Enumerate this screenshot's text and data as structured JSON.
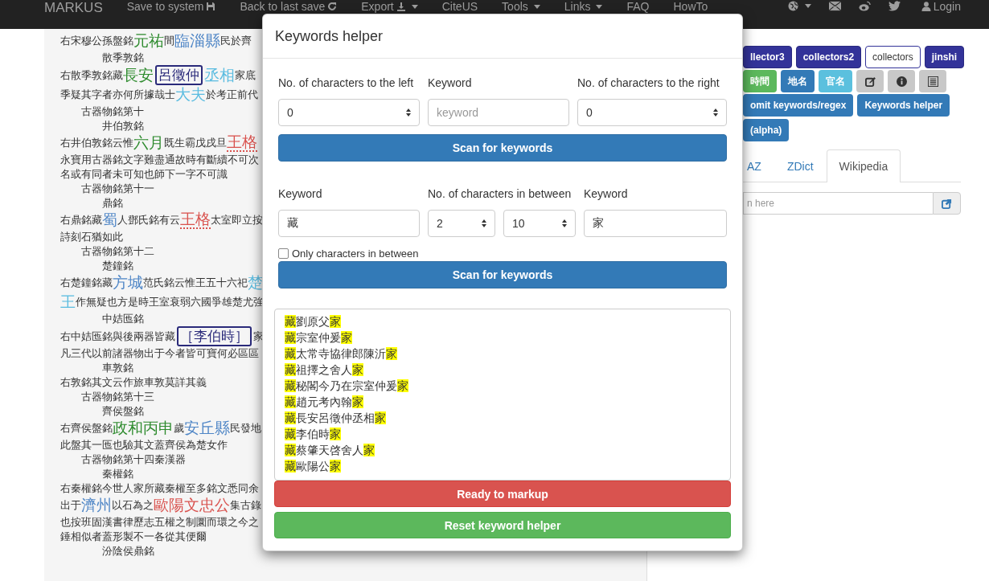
{
  "navbar": {
    "brand": "MARKUS",
    "items": [
      {
        "label": "Save to system",
        "dropdown": false
      },
      {
        "label": "Back to last save",
        "dropdown": false
      },
      {
        "label": "Export",
        "dropdown": true
      },
      {
        "label": "CiteUS",
        "dropdown": false
      },
      {
        "label": "Tools",
        "dropdown": true
      },
      {
        "label": "Links",
        "dropdown": true
      },
      {
        "label": "FAQ",
        "dropdown": false
      },
      {
        "label": "HowTo",
        "dropdown": false
      }
    ],
    "icon_items": [
      {
        "dropdown": true
      },
      {
        "dropdown": false
      },
      {
        "dropdown": false
      },
      {
        "dropdown": false
      }
    ],
    "login": "Login"
  },
  "text_lines": [
    {
      "kind": "text",
      "segments": [
        {
          "text": "右宋穆公孫盤銘",
          "kind": "plain"
        },
        {
          "text": "元祐",
          "kind": "time"
        },
        {
          "text": "間",
          "kind": "plain"
        },
        {
          "text": "臨淄縣",
          "kind": "place"
        },
        {
          "text": "民於齊",
          "kind": "plain"
        }
      ]
    },
    {
      "kind": "item",
      "segments": [
        {
          "text": "散季敦銘",
          "kind": "plain"
        }
      ]
    },
    {
      "kind": "text",
      "segments": [
        {
          "text": "右散季敦銘藏",
          "kind": "plain"
        },
        {
          "text": "長安",
          "kind": "time"
        },
        {
          "text": "呂徵仲",
          "kind": "person"
        },
        {
          "text": "丞相",
          "kind": "office"
        },
        {
          "text": "家底",
          "kind": "plain"
        }
      ]
    },
    {
      "kind": "text",
      "segments": [
        {
          "text": "季疑其字者亦何所據哉士",
          "kind": "plain"
        },
        {
          "text": "大夫",
          "kind": "office"
        },
        {
          "text": "於考正前代",
          "kind": "plain"
        }
      ]
    },
    {
      "kind": "section",
      "segments": [
        {
          "text": "古器物銘第十",
          "kind": "plain"
        }
      ]
    },
    {
      "kind": "item",
      "segments": [
        {
          "text": "井伯敦銘",
          "kind": "plain"
        }
      ]
    },
    {
      "kind": "text",
      "segments": [
        {
          "text": "右井伯敦銘云惟",
          "kind": "plain"
        },
        {
          "text": "六月",
          "kind": "time"
        },
        {
          "text": "既生霸戊戌旦",
          "kind": "plain"
        },
        {
          "text": "王格",
          "kind": "title"
        }
      ]
    },
    {
      "kind": "text",
      "segments": [
        {
          "text": "永寶用古器銘文字難盡通故時有斷續不可次",
          "kind": "plain"
        }
      ]
    },
    {
      "kind": "text",
      "segments": [
        {
          "text": "名或有同者未可知也師下一字不可識",
          "kind": "plain"
        }
      ]
    },
    {
      "kind": "section",
      "segments": [
        {
          "text": "古器物銘第十一",
          "kind": "plain"
        }
      ]
    },
    {
      "kind": "item",
      "segments": [
        {
          "text": "鼎銘",
          "kind": "plain"
        }
      ]
    },
    {
      "kind": "text",
      "segments": [
        {
          "text": "右鼎銘藏",
          "kind": "plain"
        },
        {
          "text": "蜀",
          "kind": "place"
        },
        {
          "text": "人鄧氏銘有云",
          "kind": "plain"
        },
        {
          "text": "王格",
          "kind": "title"
        },
        {
          "text": "太室即立按",
          "kind": "plain"
        }
      ]
    },
    {
      "kind": "text",
      "segments": [
        {
          "text": "詩刻石猶如此",
          "kind": "plain"
        }
      ]
    },
    {
      "kind": "section",
      "segments": [
        {
          "text": "古器物銘第十二",
          "kind": "plain"
        }
      ]
    },
    {
      "kind": "item",
      "segments": [
        {
          "text": "楚鐘銘",
          "kind": "plain"
        }
      ]
    },
    {
      "kind": "text",
      "segments": [
        {
          "text": "右楚鐘銘藏",
          "kind": "plain"
        },
        {
          "text": "方城",
          "kind": "place"
        },
        {
          "text": "范氏銘云惟王五十六祀",
          "kind": "plain"
        },
        {
          "text": "楚",
          "kind": "office"
        }
      ]
    },
    {
      "kind": "text",
      "segments": [
        {
          "text": "王",
          "kind": "office"
        },
        {
          "text": "作無疑也方是時王室衰弱六國爭雄楚尤強",
          "kind": "plain"
        }
      ]
    },
    {
      "kind": "item",
      "segments": [
        {
          "text": "中姞匜銘",
          "kind": "plain"
        }
      ]
    },
    {
      "kind": "text",
      "segments": [
        {
          "text": "右中姞匜銘與後兩器皆藏",
          "kind": "plain"
        },
        {
          "text": "［李伯時］",
          "kind": "person"
        },
        {
          "text": "家",
          "kind": "plain"
        }
      ]
    },
    {
      "kind": "text",
      "segments": [
        {
          "text": "凡三代以前諸器物出于今者皆可寶何必區區",
          "kind": "plain"
        }
      ]
    },
    {
      "kind": "item",
      "segments": [
        {
          "text": "車敦銘",
          "kind": "plain"
        }
      ]
    },
    {
      "kind": "text",
      "segments": [
        {
          "text": "右敦銘其文云作旅車敦莫詳其義",
          "kind": "plain"
        }
      ]
    },
    {
      "kind": "section",
      "segments": [
        {
          "text": "古器物銘第十三",
          "kind": "plain"
        }
      ]
    },
    {
      "kind": "item",
      "segments": [
        {
          "text": "齊侯盤銘",
          "kind": "plain"
        }
      ]
    },
    {
      "kind": "text",
      "segments": [
        {
          "text": "右齊侯盤銘",
          "kind": "plain"
        },
        {
          "text": "政和丙申",
          "kind": "time"
        },
        {
          "text": "歲",
          "kind": "plain"
        },
        {
          "text": "安丘縣",
          "kind": "place"
        },
        {
          "text": "民發地",
          "kind": "plain"
        }
      ]
    },
    {
      "kind": "text",
      "segments": [
        {
          "text": "此盤其一匜也驗其文蓋齊侯為楚女作",
          "kind": "plain"
        }
      ]
    },
    {
      "kind": "section",
      "segments": [
        {
          "text": "古器物銘第十四秦漢器",
          "kind": "plain"
        }
      ]
    },
    {
      "kind": "item",
      "segments": [
        {
          "text": "秦權銘",
          "kind": "plain"
        }
      ]
    },
    {
      "kind": "text",
      "segments": [
        {
          "text": "右秦權銘今世人家所藏秦權至多銘文悉同余",
          "kind": "plain"
        }
      ]
    },
    {
      "kind": "text",
      "segments": [
        {
          "text": "出于",
          "kind": "plain"
        },
        {
          "text": "濟州",
          "kind": "place"
        },
        {
          "text": "以石為之",
          "kind": "plain"
        },
        {
          "text": "歐陽文忠公",
          "kind": "name"
        },
        {
          "text": "集古錄",
          "kind": "plain"
        }
      ]
    },
    {
      "kind": "text",
      "segments": [
        {
          "text": "也按班固漢書律歷志五權之制圜而環之今之",
          "kind": "plain"
        }
      ]
    },
    {
      "kind": "text",
      "segments": [
        {
          "text": "錘相似者蓋形製不一各從其便爾",
          "kind": "plain"
        }
      ]
    },
    {
      "kind": "item",
      "segments": [
        {
          "text": "汾陰侯鼎銘",
          "kind": "plain"
        }
      ]
    }
  ],
  "tag_buttons": [
    {
      "label": "llector3",
      "selected": false
    },
    {
      "label": "collectors2",
      "selected": false
    },
    {
      "label": "collectors",
      "selected": true
    },
    {
      "label": "jinshi",
      "selected": false
    }
  ],
  "markup_buttons": [
    {
      "kind": "time",
      "label": "時間"
    },
    {
      "kind": "place",
      "label": "地名"
    },
    {
      "kind": "office",
      "label": "官名"
    },
    {
      "kind": "edit"
    },
    {
      "kind": "info"
    },
    {
      "kind": "list"
    }
  ],
  "action_buttons": [
    "omit keywords/regex",
    "Keywords helper",
    "(alpha)"
  ],
  "reference_tabs": [
    {
      "label": "AZ",
      "selected": false
    },
    {
      "label": "ZDict",
      "selected": false
    },
    {
      "label": "Wikipedia",
      "selected": true
    }
  ],
  "search": {
    "placeholder": "n here"
  },
  "modal": {
    "title": "Keywords helper",
    "context_scan": {
      "left_label": "No. of characters to the left",
      "keyword_label": "Keyword",
      "right_label": "No. of characters to the right",
      "left_value": "0",
      "keyword_placeholder": "keyword",
      "right_value": "0",
      "button": "Scan for keywords"
    },
    "between_scan": {
      "first_label": "Keyword",
      "between_label": "No. of characters in between",
      "second_label": "Keyword",
      "first_value": "藏",
      "min_value": "2",
      "max_value": "10",
      "second_value": "家",
      "only_between": {
        "label": "Only characters in between",
        "checked": false
      },
      "button": "Scan for keywords"
    },
    "results": [
      {
        "start": "藏",
        "middle": "劉原父",
        "end": "家"
      },
      {
        "start": "藏",
        "middle": "宗室仲爰",
        "end": "家"
      },
      {
        "start": "藏",
        "middle": "太常寺協律郎陳沂",
        "end": "家"
      },
      {
        "start": "藏",
        "middle": "祖擇之舍人",
        "end": "家"
      },
      {
        "start": "藏",
        "middle": "秘閣今乃在宗室仲爰",
        "end": "家"
      },
      {
        "start": "藏",
        "middle": "趙元考內翰",
        "end": "家"
      },
      {
        "start": "藏",
        "middle": "長安呂徵仲丞相",
        "end": "家"
      },
      {
        "start": "藏",
        "middle": "李伯時",
        "end": "家"
      },
      {
        "start": "藏",
        "middle": "蔡肇天啓舍人",
        "end": "家"
      },
      {
        "start": "藏",
        "middle": "歐陽公",
        "end": "家"
      }
    ],
    "markup_button": "Ready to markup",
    "reset_button": "Reset keyword helper"
  }
}
